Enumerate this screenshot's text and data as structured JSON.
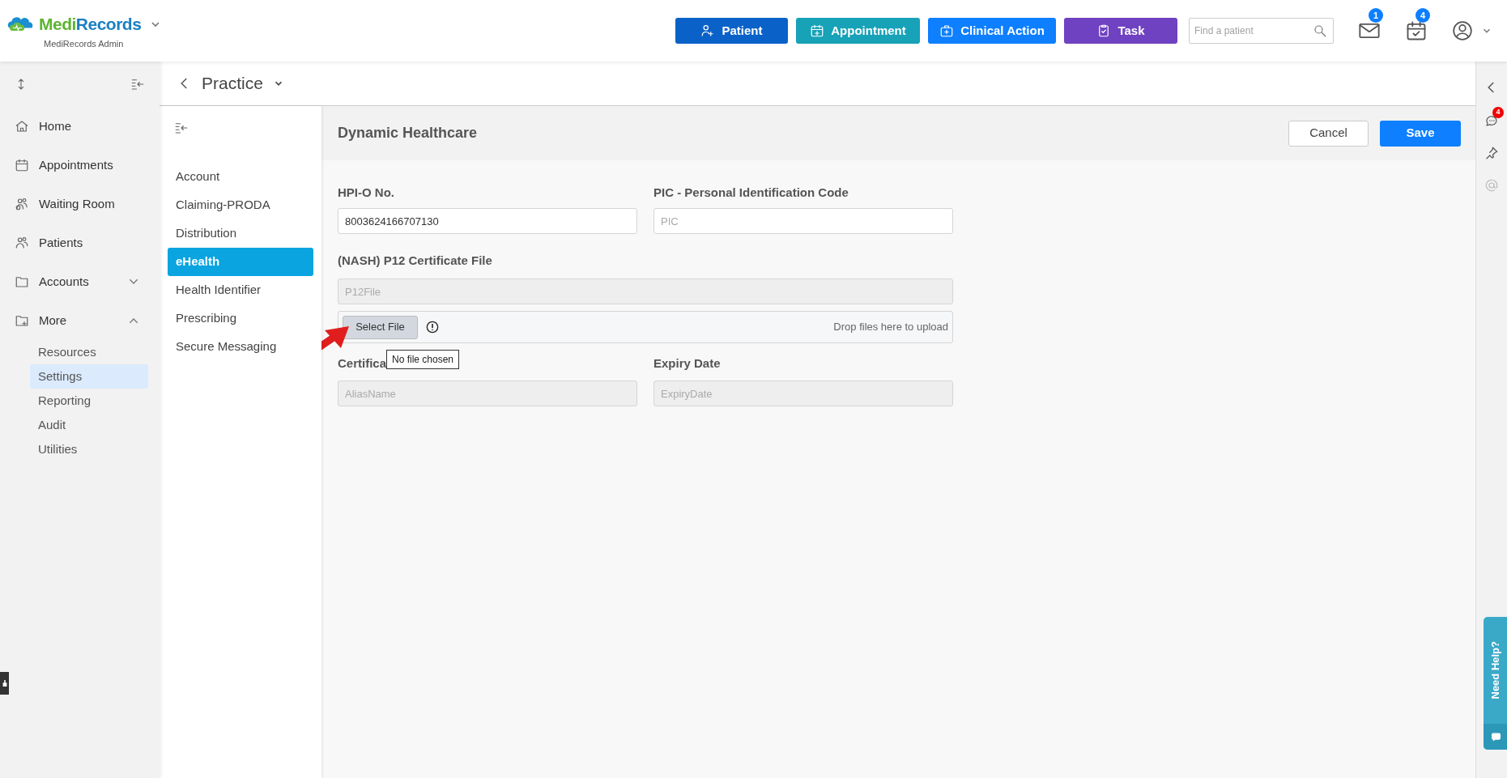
{
  "brand": {
    "name_a": "Medi",
    "name_b": "Records",
    "subtitle": "MediRecords Admin"
  },
  "header_buttons": [
    {
      "label": "Patient",
      "kind": "patient",
      "color": "#0a62c9"
    },
    {
      "label": "Appointment",
      "kind": "appointment",
      "color": "#17a2b8"
    },
    {
      "label": "Clinical Action",
      "kind": "clinical",
      "color": "#0d7fff"
    },
    {
      "label": "Task",
      "kind": "task",
      "color": "#6f42c1"
    }
  ],
  "search": {
    "placeholder": "Find a patient"
  },
  "notifications": [
    {
      "kind": "mail",
      "count": "1"
    },
    {
      "kind": "calendar",
      "count": "4"
    }
  ],
  "sidebar": {
    "items": [
      {
        "label": "Home",
        "kind": "home"
      },
      {
        "label": "Appointments",
        "kind": "calendar"
      },
      {
        "label": "Waiting Room",
        "kind": "waiting"
      },
      {
        "label": "Patients",
        "kind": "patients"
      },
      {
        "label": "Accounts",
        "kind": "folder",
        "expanded": false
      },
      {
        "label": "More",
        "kind": "folder-plus",
        "expanded": true,
        "children": [
          {
            "label": "Resources",
            "selected": false
          },
          {
            "label": "Settings",
            "selected": true
          },
          {
            "label": "Reporting",
            "selected": false
          },
          {
            "label": "Audit",
            "selected": false
          },
          {
            "label": "Utilities",
            "selected": false
          }
        ]
      }
    ]
  },
  "breadcrumb": {
    "title": "Practice"
  },
  "subnav": [
    {
      "label": "Account",
      "selected": false
    },
    {
      "label": "Claiming-PRODA",
      "selected": false
    },
    {
      "label": "Distribution",
      "selected": false
    },
    {
      "label": "eHealth",
      "selected": true
    },
    {
      "label": "Health Identifier",
      "selected": false
    },
    {
      "label": "Prescribing",
      "selected": false
    },
    {
      "label": "Secure Messaging",
      "selected": false
    }
  ],
  "panel": {
    "title": "Dynamic Healthcare",
    "buttons": [
      {
        "label": "Cancel",
        "kind": "secondary"
      },
      {
        "label": "Save",
        "kind": "primary"
      }
    ]
  },
  "form": {
    "hpio": {
      "label": "HPI-O No.",
      "value": "8003624166707130"
    },
    "pic": {
      "label": "PIC - Personal Identification Code",
      "placeholder": "PIC"
    },
    "p12": {
      "label": "(NASH) P12 Certificate File",
      "placeholder": "P12File",
      "disabled": true
    },
    "upload": {
      "button": "Select File",
      "drop_hint": "Drop files here to upload",
      "tooltip": "No file chosen"
    },
    "alias": {
      "label": "Certifica",
      "placeholder": "AliasName",
      "disabled": true
    },
    "expiry": {
      "label": "Expiry Date",
      "placeholder": "ExpiryDate",
      "disabled": true
    }
  },
  "right_rail": {
    "chat_count": "4"
  },
  "help_tab": {
    "label": "Need Help?"
  }
}
